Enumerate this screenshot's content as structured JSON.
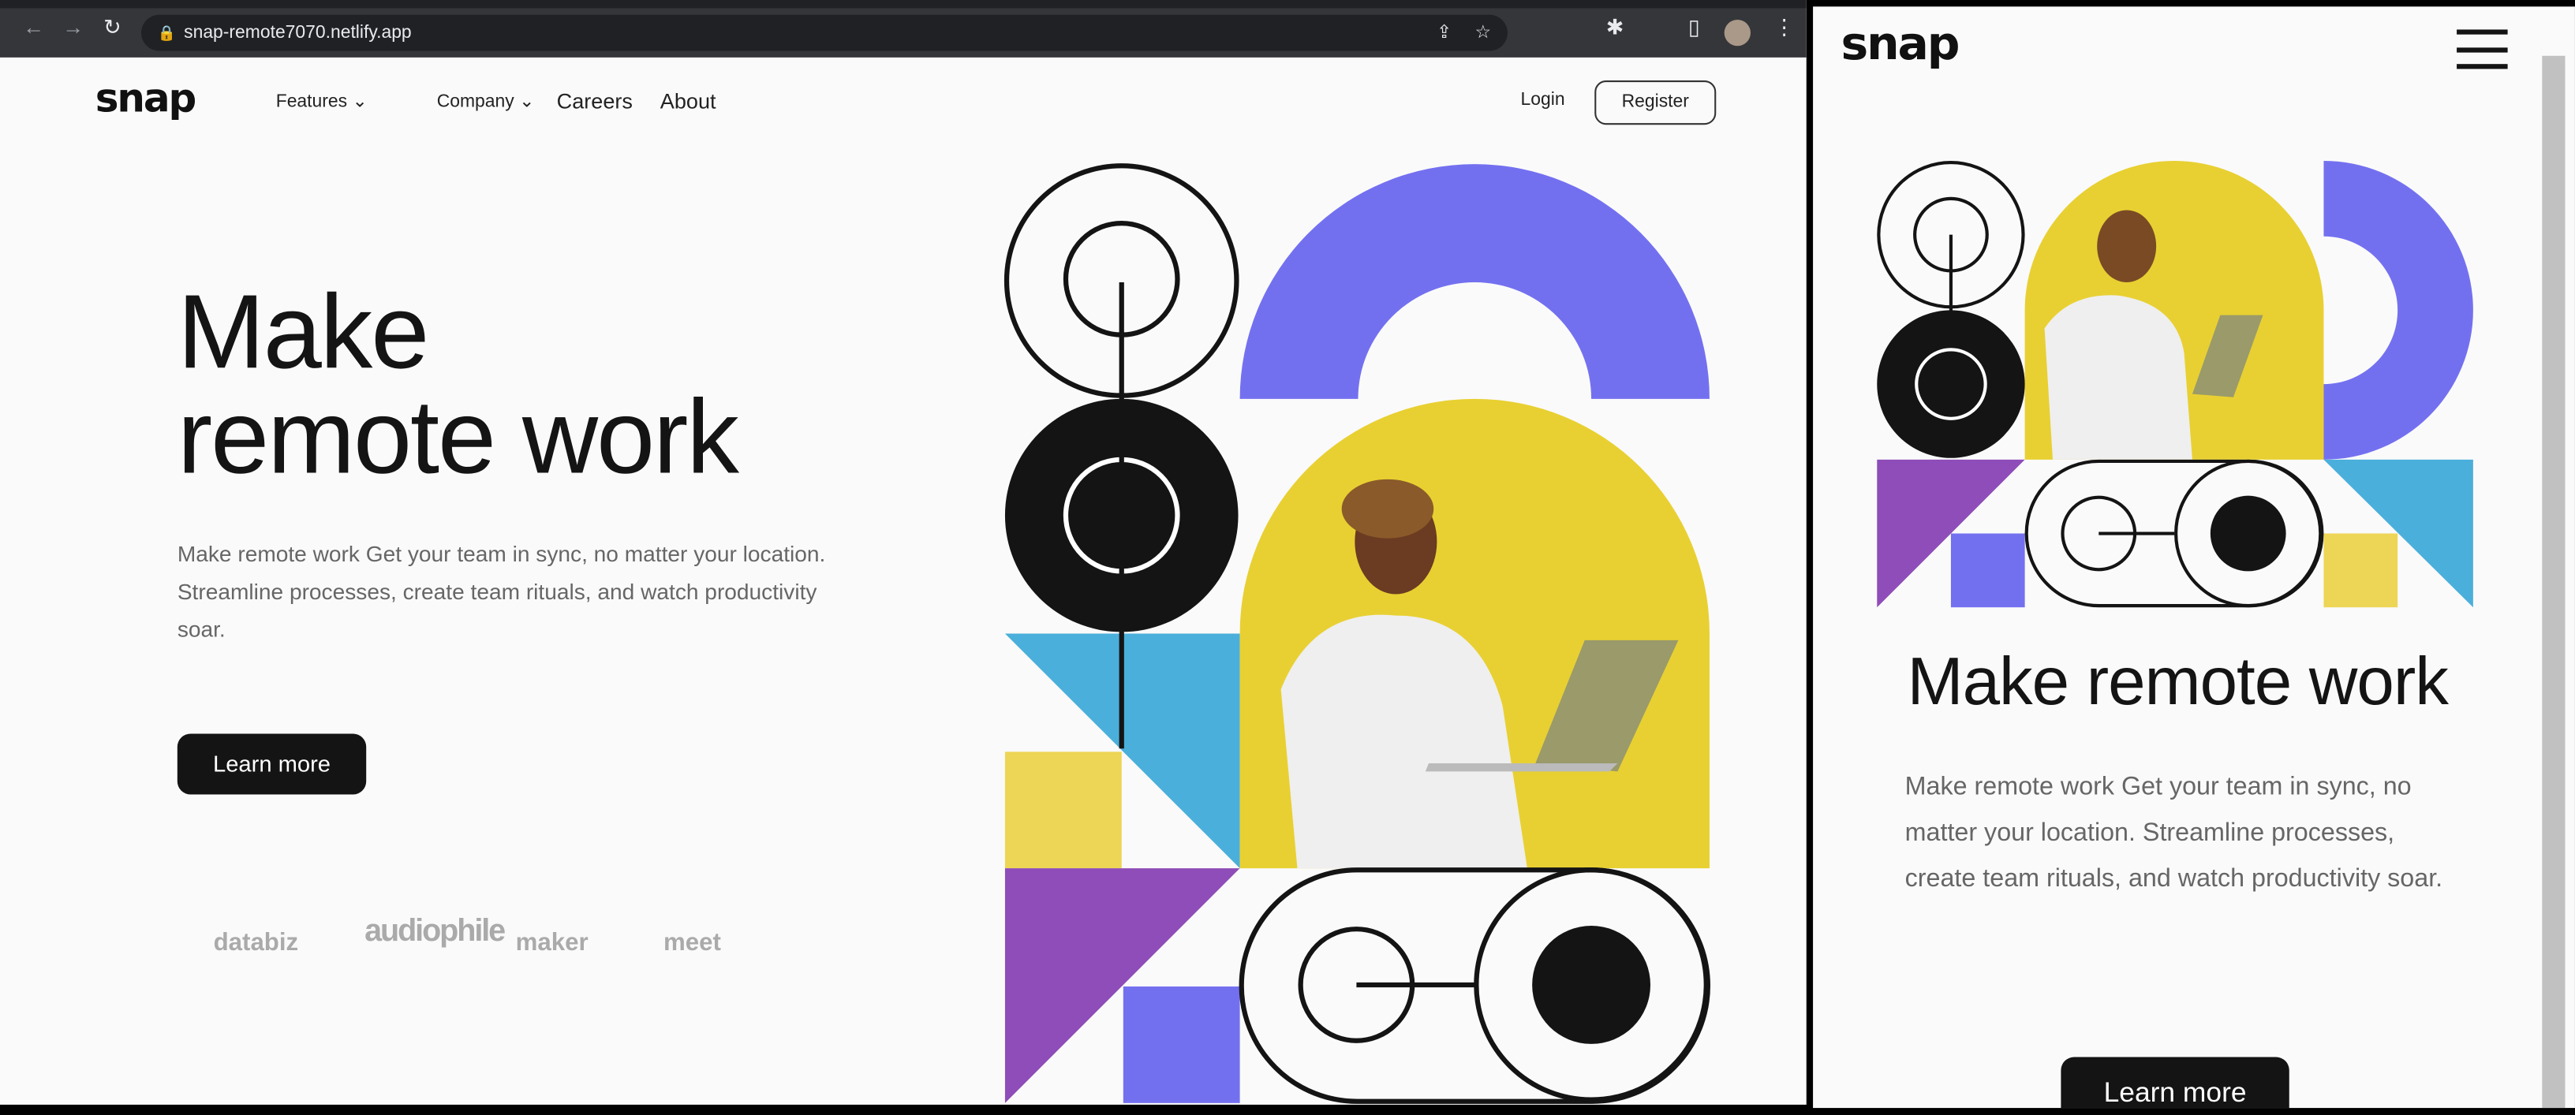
{
  "browser": {
    "url": "snap-remote7070.netlify.app"
  },
  "nav": {
    "logo": "snap",
    "features": "Features",
    "company": "Company",
    "careers": "Careers",
    "about": "About",
    "login": "Login",
    "register": "Register"
  },
  "hero": {
    "title_line1": "Make",
    "title_line2": "remote work",
    "title_mobile": "Make remote work",
    "description": "Make remote work Get your team in sync, no matter your location. Streamline processes, create team rituals, and watch productivity soar.",
    "cta": "Learn more"
  },
  "clients": [
    "databiz",
    "audiophile",
    "maker",
    "meet"
  ],
  "colors": {
    "purple": "#7370f0",
    "yellow": "#e8d032",
    "blue": "#4bafdb",
    "violet": "#8e4db8",
    "dark": "#141414"
  }
}
